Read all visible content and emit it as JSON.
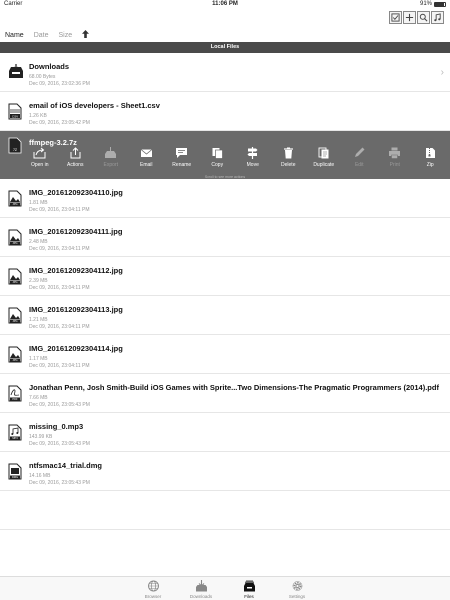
{
  "status_bar": {
    "carrier": "Carrier",
    "time": "11:06 PM",
    "battery": "91%"
  },
  "toolbar": {
    "buttons": [
      {
        "icon": "select-check-icon",
        "label": "☑"
      },
      {
        "icon": "add-icon",
        "label": "+"
      },
      {
        "icon": "search-icon",
        "label": ""
      },
      {
        "icon": "music-icon",
        "label": "♫"
      }
    ]
  },
  "sort_bar": {
    "name": "Name",
    "date": "Date",
    "size": "Size",
    "direction": "up-arrow-icon"
  },
  "section_header": "Local Files",
  "files": [
    {
      "name": "Downloads",
      "size": "68.00 Bytes",
      "date": "Dec 09, 2016, 23:02:36 PM",
      "type": "folder",
      "chevron": "›"
    },
    {
      "name": "email of iOS developers - Sheet1.csv",
      "size": "1.26 KB",
      "date": "Dec 09, 2016, 23:05:42 PM",
      "type": "CSV"
    },
    {
      "name": "ffmpeg-3.2.7z",
      "type": "7Z",
      "selected": true
    },
    {
      "name": "IMG_201612092304110.jpg",
      "size": "1.81 MB",
      "date": "Dec 09, 2016, 23:04:11 PM",
      "type": "JPG"
    },
    {
      "name": "IMG_201612092304111.jpg",
      "size": "2.48 MB",
      "date": "Dec 09, 2016, 23:04:11 PM",
      "type": "JPG"
    },
    {
      "name": "IMG_201612092304112.jpg",
      "size": "2.39 MB",
      "date": "Dec 09, 2016, 23:04:11 PM",
      "type": "JPG"
    },
    {
      "name": "IMG_201612092304113.jpg",
      "size": "1.21 MB",
      "date": "Dec 09, 2016, 23:04:11 PM",
      "type": "JPG"
    },
    {
      "name": "IMG_201612092304114.jpg",
      "size": "1.17 MB",
      "date": "Dec 09, 2016, 23:04:11 PM",
      "type": "JPG"
    },
    {
      "name": "Jonathan Penn, Josh Smith-Build iOS Games with Sprite...Two Dimensions-The Pragmatic Programmers (2014).pdf",
      "size": "7.66 MB",
      "date": "Dec 09, 2016, 23:05:43 PM",
      "type": "PDF"
    },
    {
      "name": "missing_0.mp3",
      "size": "143.99 KB",
      "date": "Dec 09, 2016, 23:05:43 PM",
      "type": "MP3"
    },
    {
      "name": "ntfsmac14_trial.dmg",
      "size": "14.16 MB",
      "date": "Dec 09, 2016, 23:05:43 PM",
      "type": "DMG"
    }
  ],
  "actions": [
    {
      "label": "Open in",
      "icon": "share-icon",
      "enabled": true
    },
    {
      "label": "Actions",
      "icon": "actions-upload-icon",
      "enabled": true
    },
    {
      "label": "Export",
      "icon": "export-tray-icon",
      "enabled": false
    },
    {
      "label": "Email",
      "icon": "mail-icon",
      "enabled": true
    },
    {
      "label": "Rename",
      "icon": "rename-bubble-icon",
      "enabled": true
    },
    {
      "label": "Copy",
      "icon": "copy-icon",
      "enabled": true
    },
    {
      "label": "Move",
      "icon": "move-signpost-icon",
      "enabled": true
    },
    {
      "label": "Delete",
      "icon": "trash-icon",
      "enabled": true
    },
    {
      "label": "Duplicate",
      "icon": "duplicate-icon",
      "enabled": true
    },
    {
      "label": "Edit",
      "icon": "pencil-icon",
      "enabled": false
    },
    {
      "label": "Print",
      "icon": "printer-icon",
      "enabled": false
    },
    {
      "label": "Zip",
      "icon": "zip-icon",
      "enabled": true
    }
  ],
  "scroll_hint": "Scroll to see more actions",
  "tabs": [
    {
      "label": "Browser",
      "icon": "globe-icon",
      "active": false
    },
    {
      "label": "Downloads",
      "icon": "download-tray-icon",
      "active": false
    },
    {
      "label": "Files",
      "icon": "files-tray-icon",
      "active": true
    },
    {
      "label": "Settings",
      "icon": "gear-icon",
      "active": false
    }
  ],
  "colors": {
    "section_header_bg": "#4a4a4a",
    "selected_row_bg": "#6a6a6a",
    "meta_text": "#999999"
  }
}
